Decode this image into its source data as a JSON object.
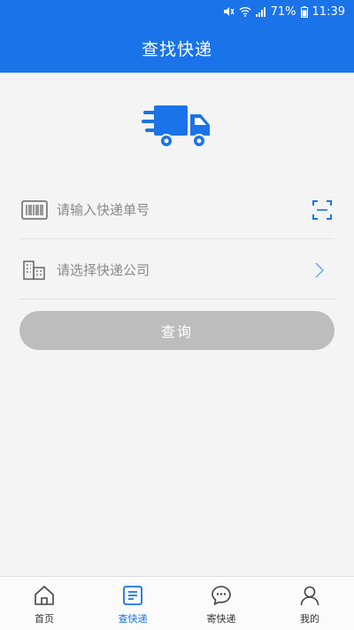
{
  "status_bar": {
    "battery": "71%",
    "time": "11:39"
  },
  "header": {
    "title": "查找快递"
  },
  "form": {
    "tracking_placeholder": "请输入快递单号",
    "company_label": "请选择快递公司",
    "query_label": "查询"
  },
  "tabs": [
    {
      "label": "首页",
      "icon": "home-icon"
    },
    {
      "label": "查快递",
      "icon": "tracking-list-icon"
    },
    {
      "label": "寄快递",
      "icon": "chat-bubble-icon"
    },
    {
      "label": "我的",
      "icon": "user-icon"
    }
  ],
  "colors": {
    "brand": "#1a73e8",
    "button_disabled": "#bdbdbd",
    "background": "#f4f4f4"
  }
}
